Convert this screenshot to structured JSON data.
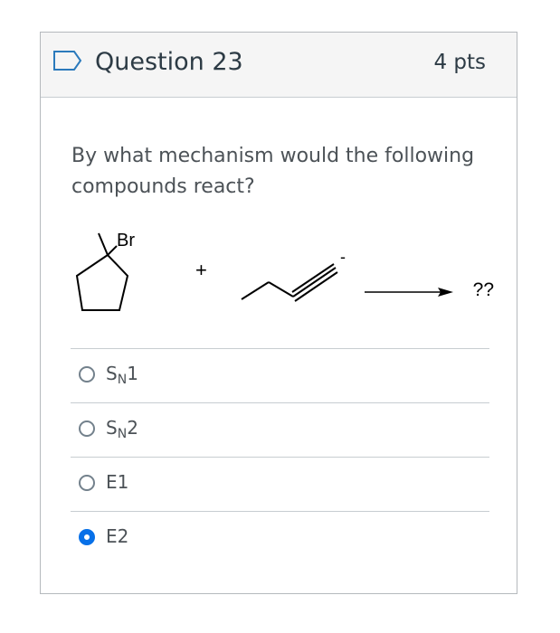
{
  "question": {
    "title": "Question 23",
    "points": "4 pts",
    "text": "By what mechanism would the following compounds react?"
  },
  "reaction": {
    "reactant_label": "Br",
    "plus": "+",
    "charge": "-",
    "product": "??"
  },
  "answers": [
    {
      "main": "S",
      "sub": "N",
      "tail": "1",
      "selected": false
    },
    {
      "main": "S",
      "sub": "N",
      "tail": "2",
      "selected": false
    },
    {
      "main": "E1",
      "sub": "",
      "tail": "",
      "selected": false
    },
    {
      "main": "E2",
      "sub": "",
      "tail": "",
      "selected": true
    }
  ],
  "colors": {
    "accent": "#0770e8",
    "header_bg": "#f5f5f5",
    "text": "#2d3b45"
  }
}
